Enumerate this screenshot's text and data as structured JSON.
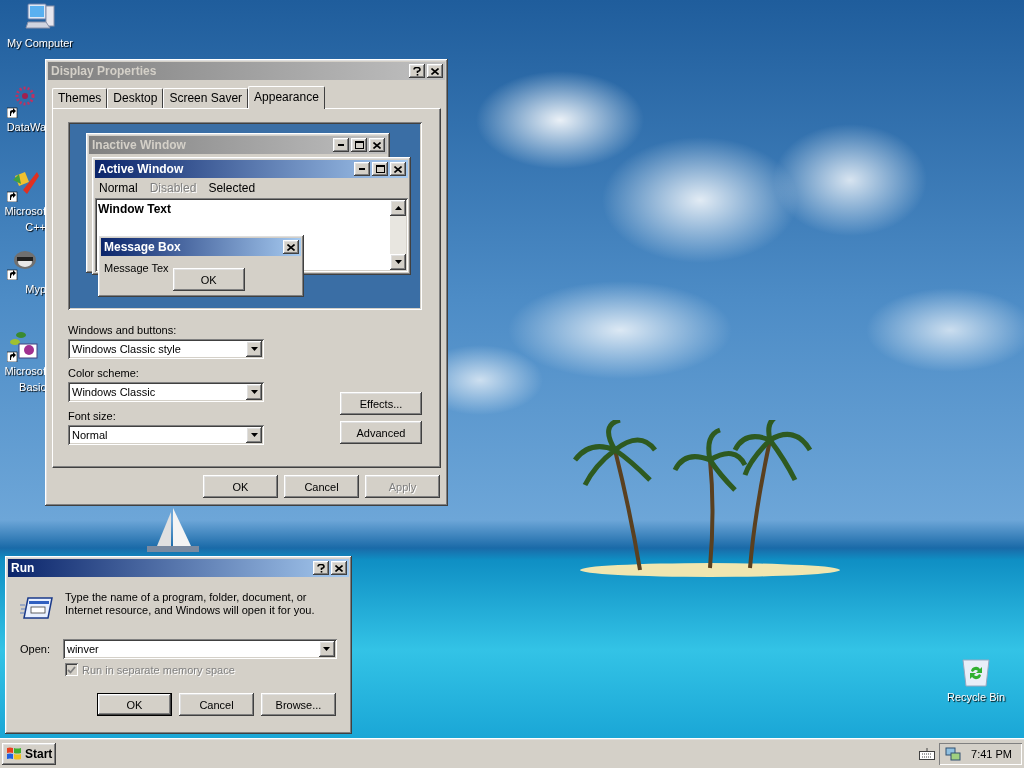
{
  "desktop_icons": [
    {
      "kind": "computer",
      "lines": [
        "My Computer"
      ]
    },
    {
      "kind": "flower",
      "lines": [
        "DataWa"
      ]
    },
    {
      "kind": "studio",
      "lines": [
        "Microsof",
        "C++"
      ]
    },
    {
      "kind": "raccoon",
      "lines": [
        "Myp"
      ]
    },
    {
      "kind": "basic",
      "lines": [
        "Microsof",
        "Basic"
      ]
    }
  ],
  "recycle_bin": {
    "label": "Recycle Bin"
  },
  "display_properties": {
    "title": "Display Properties",
    "active": false,
    "tabs": [
      {
        "label": "Themes",
        "selected": false
      },
      {
        "label": "Desktop",
        "selected": false
      },
      {
        "label": "Screen Saver",
        "selected": false
      },
      {
        "label": "Appearance",
        "selected": true
      }
    ],
    "preview": {
      "inactive_title": "Inactive Window",
      "active_title": "Active Window",
      "menu": [
        {
          "label": "Normal",
          "disabled": false
        },
        {
          "label": "Disabled",
          "disabled": true
        },
        {
          "label": "Selected",
          "disabled": false
        }
      ],
      "window_text": "Window Text",
      "message_title": "Message Box",
      "message_text": "Message Tex",
      "message_button": "OK"
    },
    "fields": [
      {
        "label": "Windows and buttons:",
        "value": "Windows Classic style"
      },
      {
        "label": "Color scheme:",
        "value": "Windows Classic"
      },
      {
        "label": "Font size:",
        "value": "Normal"
      }
    ],
    "side_buttons": [
      "Effects...",
      "Advanced"
    ],
    "buttons": [
      {
        "label": "OK",
        "disabled": false
      },
      {
        "label": "Cancel",
        "disabled": false
      },
      {
        "label": "Apply",
        "disabled": true
      }
    ]
  },
  "run": {
    "title": "Run",
    "active": true,
    "prompt": "Type the name of a program, folder, document, or Internet resource, and Windows will open it for you.",
    "open_label": "Open:",
    "value": "winver",
    "checkbox": {
      "label": "Run in separate memory space",
      "checked": true,
      "disabled": true
    },
    "buttons": [
      {
        "label": "OK",
        "default": true
      },
      {
        "label": "Cancel",
        "default": false
      },
      {
        "label": "Browse...",
        "default": false
      }
    ]
  },
  "taskbar": {
    "start": "Start",
    "clock": "7:41 PM"
  }
}
